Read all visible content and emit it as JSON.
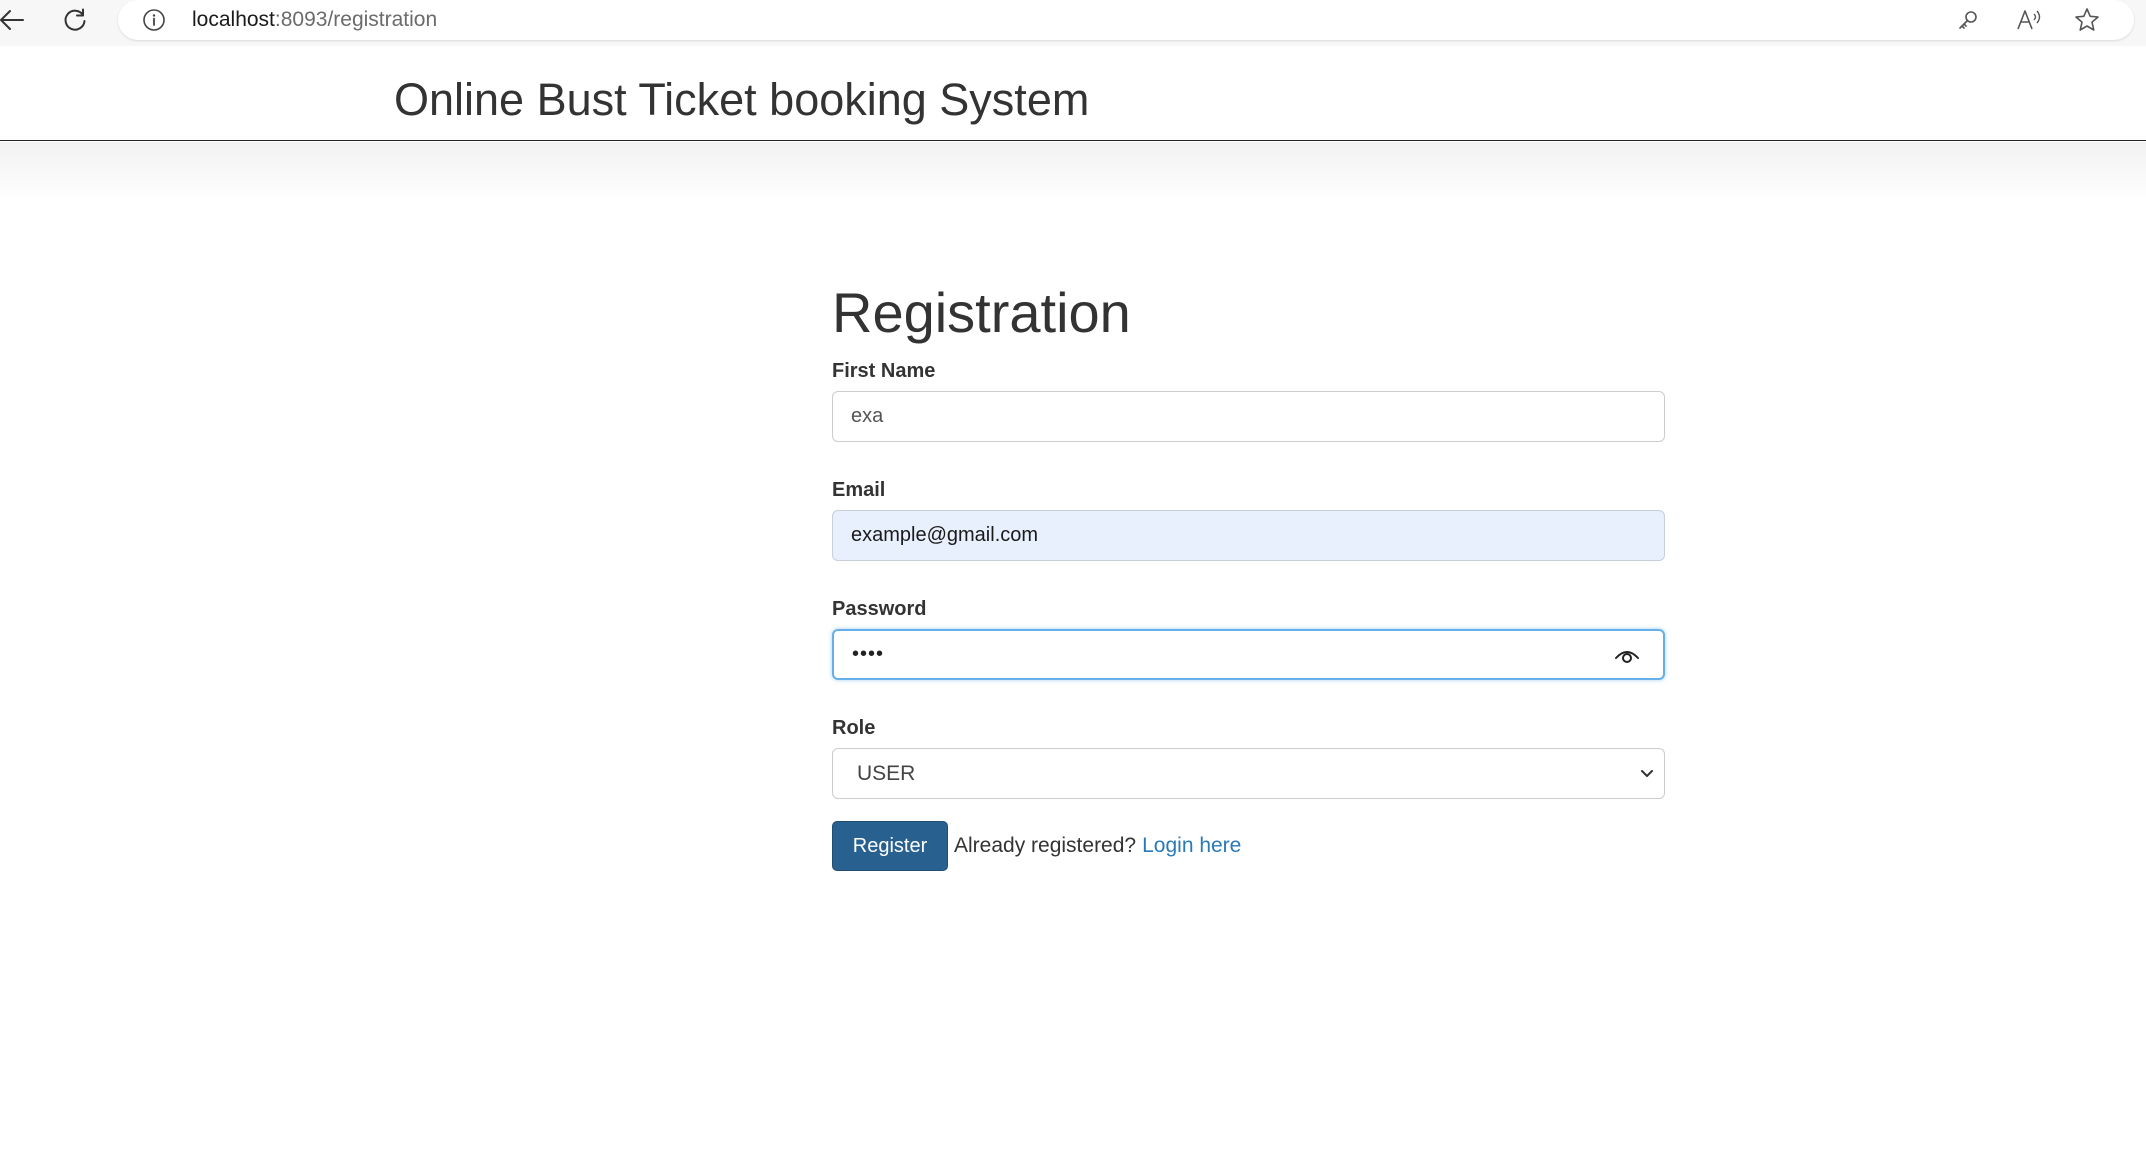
{
  "browser": {
    "url_host": "localhost",
    "url_rest": ":8093/registration"
  },
  "header": {
    "title": "Online Bust Ticket booking System"
  },
  "form": {
    "heading": "Registration",
    "first_name": {
      "label": "First Name",
      "value": "exa"
    },
    "email": {
      "label": "Email",
      "value": "example@gmail.com"
    },
    "password": {
      "label": "Password",
      "value": "••••"
    },
    "role": {
      "label": "Role",
      "selected": "USER"
    },
    "register_label": "Register",
    "already_text": "Already registered?",
    "login_link": "Login here"
  },
  "colors": {
    "primary_button": "#286090",
    "link": "#2a7ab8",
    "autofill_bg": "#e8f0fe",
    "focus_border": "#66afe9"
  }
}
